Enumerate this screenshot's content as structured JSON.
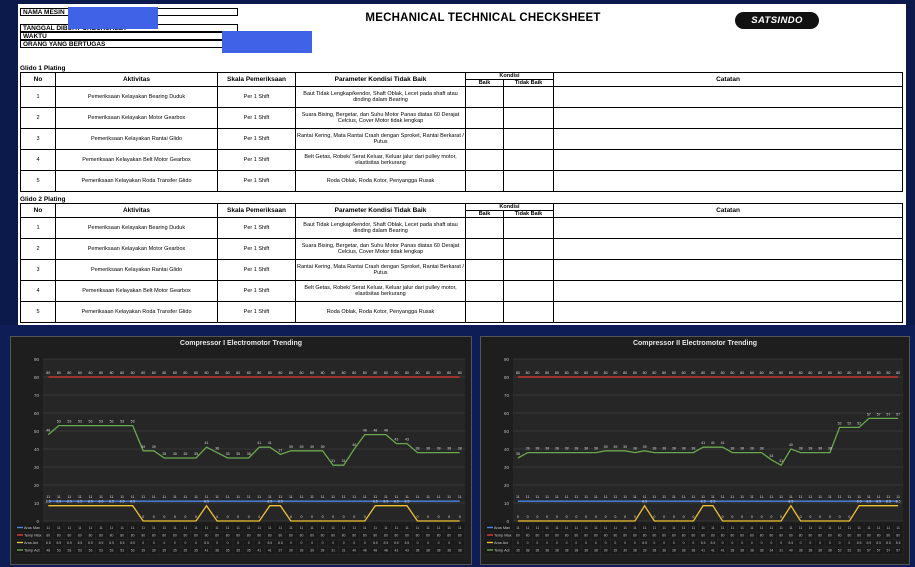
{
  "sheet": {
    "title": "MECHANICAL TECHNICAL CHECKSHEET",
    "logo": "SATSINDO",
    "info_labels": [
      "NAMA MESIN",
      "TANGGAL DIBUAT CHECKSHEET",
      "WAKTU",
      "ORANG YANG BERTUGAS"
    ],
    "colors": {
      "highlight": "#3f62e6"
    },
    "sections": [
      {
        "title": "Glido 1 Plating",
        "headers": {
          "no": "No",
          "aktivitas": "Aktivitas",
          "skala": "Skala Pemeriksaan",
          "parameter": "Parameter Kondisi Tidak Baik",
          "kondisi": "Kondisi",
          "baik": "Baik",
          "tidak_baik": "Tidak Baik",
          "catatan": "Catatan"
        },
        "rows": [
          {
            "no": "1",
            "aktivitas": "Pemeriksaan Kelayakan Bearing Duduk",
            "skala": "Per 1 Shift",
            "parameter": "Baut Tidak Lengkap/kendor, Shaft Oblak, Lecet pada shaft atau dinding dalam Bearing"
          },
          {
            "no": "2",
            "aktivitas": "Pemeriksaan Kelayakan Motor Gearbox",
            "skala": "Per 1 Shift",
            "parameter": "Suara Bising, Bergetar, dan Suhu Motor Panas diatas 60 Derajat Celcius, Cover Motor tidak lengkap"
          },
          {
            "no": "3",
            "aktivitas": "Pemeriksaan Kelayakan Rantai Glido",
            "skala": "Per 1 Shift",
            "parameter": "Rantai Kering, Mata Rantai Crash dengan Sproket, Rantai Berkarat / Putus"
          },
          {
            "no": "4",
            "aktivitas": "Pemeriksaan Kelayakan Belt Motor Gearbox",
            "skala": "Per 1 Shift",
            "parameter": "Belt Getas, Robek/ Serat Keluar, Keluar jalur dari pulley motor, elastisitas berkurang"
          },
          {
            "no": "5",
            "aktivitas": "Pemeriksaan Kelayakan Roda Transfer Glido",
            "skala": "Per 1 Shift",
            "parameter": "Roda Oblak, Roda Kotor, Penyangga Rusak"
          }
        ]
      },
      {
        "title": "Glido 2 Plating",
        "headers": {
          "no": "No",
          "aktivitas": "Aktivitas",
          "skala": "Skala Pemeriksaan",
          "parameter": "Parameter Kondisi Tidak Baik",
          "kondisi": "Kondisi",
          "baik": "Baik",
          "tidak_baik": "Tidak Baik",
          "catatan": "Catatan"
        },
        "rows": [
          {
            "no": "1",
            "aktivitas": "Pemeriksaan Kelayakan Bearing Duduk",
            "skala": "Per 1 Shift",
            "parameter": "Baut Tidak Lengkap/kendor, Shaft Oblak, Lecet pada shaft atau dinding dalam Bearing"
          },
          {
            "no": "2",
            "aktivitas": "Pemeriksaan Kelayakan Motor Gearbox",
            "skala": "Per 1 Shift",
            "parameter": "Suara Bising, Bergetar, dan Suhu Motor Panas diatas 60 Derajat Celcius, Cover Motor tidak lengkap"
          },
          {
            "no": "3",
            "aktivitas": "Pemeriksaan Kelayakan Rantai Glido",
            "skala": "Per 1 Shift",
            "parameter": "Rantai Kering, Mata Rantai Crash dengan Sproket, Rantai Berkarat / Putus"
          },
          {
            "no": "4",
            "aktivitas": "Pemeriksaan Kelayakan Belt Motor Gearbox",
            "skala": "Per 1 Shift",
            "parameter": "Belt Getas, Robek/ Serat Keluar, Keluar jalur dari pulley motor, elastisitas berkurang"
          },
          {
            "no": "5",
            "aktivitas": "Pemeriksaan Kelayakan Roda Transfer Glido",
            "skala": "Per 1 Shift",
            "parameter": "Roda Oblak, Roda Kotor, Penyangga Rusak"
          }
        ]
      }
    ]
  },
  "chart_data": [
    {
      "type": "line",
      "title": "Compressor I  Electromotor Trending",
      "ylim": [
        0,
        90
      ],
      "yticks": [
        0,
        10,
        20,
        30,
        40,
        50,
        60,
        70,
        80,
        90
      ],
      "grid": true,
      "legend": "bottom-table",
      "colors": {
        "Arus Max": "#4a86e8",
        "Temp Max": "#e03c31",
        "Arus Act": "#f1c232",
        "Temp Act": "#6aa84f"
      },
      "series": [
        {
          "name": "Arus Max",
          "values": [
            11,
            11,
            11,
            11,
            11,
            11,
            11,
            11,
            11,
            11,
            11,
            11,
            11,
            11,
            11,
            11,
            11,
            11,
            11,
            11,
            11,
            11,
            11,
            11,
            11,
            11,
            11,
            11,
            11,
            11,
            11,
            11,
            11,
            11,
            11,
            11,
            11,
            11,
            11,
            11
          ]
        },
        {
          "name": "Temp Max",
          "values": [
            80,
            80,
            80,
            80,
            80,
            80,
            80,
            80,
            80,
            80,
            80,
            80,
            80,
            80,
            80,
            80,
            80,
            80,
            80,
            80,
            80,
            80,
            80,
            80,
            80,
            80,
            80,
            80,
            80,
            80,
            80,
            80,
            80,
            80,
            80,
            80,
            80,
            80,
            80,
            80
          ]
        },
        {
          "name": "Arus Act",
          "values": [
            8.5,
            8.5,
            8.5,
            8.5,
            8.5,
            8.5,
            8.5,
            8.5,
            8.5,
            0,
            0,
            0,
            0,
            0,
            0,
            8.5,
            0,
            0,
            0,
            0,
            0,
            8.5,
            8.5,
            0,
            0,
            0,
            0,
            0,
            0,
            0,
            0,
            8.5,
            8.5,
            8.5,
            8.5,
            0,
            0,
            0,
            0,
            0
          ]
        },
        {
          "name": "Temp Act",
          "values": [
            48,
            53,
            53,
            53,
            53,
            53,
            53,
            53,
            53,
            39,
            39,
            35,
            35,
            35,
            35,
            41,
            38,
            35,
            35,
            35,
            41,
            41,
            37,
            39,
            39,
            39,
            39,
            31,
            31,
            40,
            48,
            48,
            48,
            43,
            43,
            38,
            38,
            38,
            38,
            38
          ]
        }
      ]
    },
    {
      "type": "line",
      "title": "Compressor II  Electromotor Trending",
      "ylim": [
        0,
        90
      ],
      "yticks": [
        0,
        10,
        20,
        30,
        40,
        50,
        60,
        70,
        80,
        90
      ],
      "grid": true,
      "legend": "bottom-table",
      "colors": {
        "Arus Max": "#4a86e8",
        "Temp Max": "#e03c31",
        "Arus Act": "#f1c232",
        "Temp Act": "#6aa84f"
      },
      "series": [
        {
          "name": "Arus Max",
          "values": [
            11,
            11,
            11,
            11,
            11,
            11,
            11,
            11,
            11,
            11,
            11,
            11,
            11,
            11,
            11,
            11,
            11,
            11,
            11,
            11,
            11,
            11,
            11,
            11,
            11,
            11,
            11,
            11,
            11,
            11,
            11,
            11,
            11,
            11,
            11,
            11,
            11,
            11,
            11,
            11
          ]
        },
        {
          "name": "Temp Max",
          "values": [
            80,
            80,
            80,
            80,
            80,
            80,
            80,
            80,
            80,
            80,
            80,
            80,
            80,
            80,
            80,
            80,
            80,
            80,
            80,
            80,
            80,
            80,
            80,
            80,
            80,
            80,
            80,
            80,
            80,
            80,
            80,
            80,
            80,
            80,
            80,
            80,
            80,
            80,
            80,
            80
          ]
        },
        {
          "name": "Arus Act",
          "values": [
            0,
            0,
            0,
            0,
            0,
            0,
            0,
            0,
            0,
            0,
            0,
            0,
            0,
            8.5,
            0,
            0,
            0,
            0,
            0,
            8.5,
            8.5,
            0,
            0,
            0,
            0,
            0,
            0,
            0,
            8.5,
            0,
            0,
            0,
            0,
            0,
            0,
            8.5,
            8.5,
            8.5,
            8.5,
            8.5
          ]
        },
        {
          "name": "Temp Act",
          "values": [
            35,
            38,
            38,
            38,
            38,
            38,
            38,
            38,
            38,
            39,
            39,
            39,
            38,
            39,
            38,
            38,
            38,
            38,
            38,
            41,
            41,
            41,
            38,
            38,
            38,
            38,
            34,
            31,
            40,
            38,
            38,
            38,
            38,
            52,
            52,
            52,
            57,
            57,
            57,
            57
          ]
        }
      ]
    }
  ]
}
